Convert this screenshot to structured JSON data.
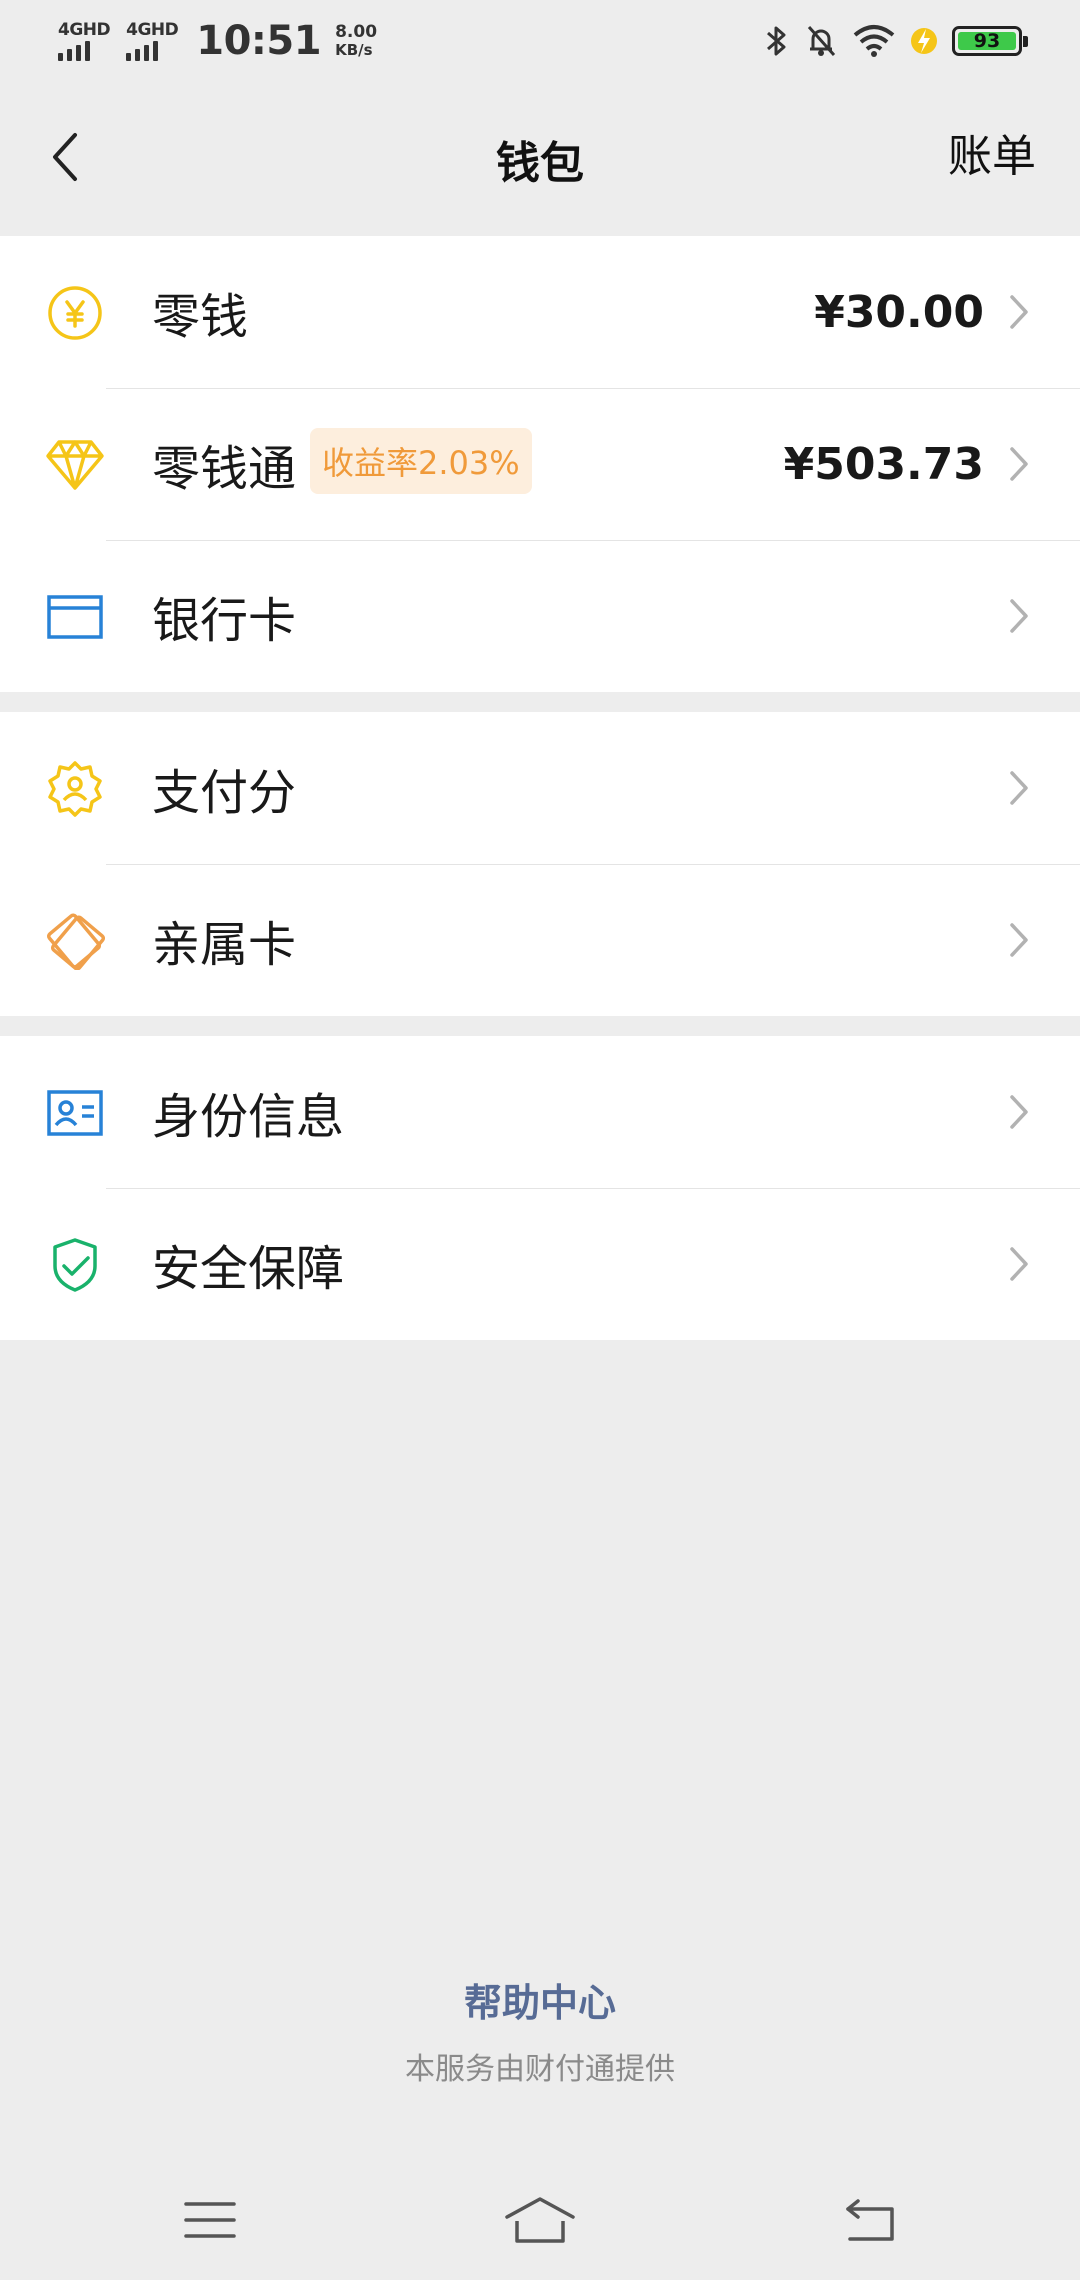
{
  "status_bar": {
    "sim1_label": "4GHD",
    "sim2_label": "4GHD",
    "time": "10:51",
    "speed_value": "8.00",
    "speed_unit": "KB/s",
    "battery_level": "93",
    "icons": [
      "bluetooth-icon",
      "mute-icon",
      "wifi-icon",
      "charging-icon",
      "battery-icon"
    ]
  },
  "nav": {
    "title": "钱包",
    "right_action": "账单",
    "back_icon": "chevron-left-icon"
  },
  "groups": [
    {
      "rows": [
        {
          "label": "零钱",
          "value": "¥30.00",
          "icon": "yuan-coin-icon"
        },
        {
          "label": "零钱通",
          "badge": "收益率2.03%",
          "value": "¥503.73",
          "icon": "diamond-icon"
        },
        {
          "label": "银行卡",
          "icon": "bank-card-icon"
        }
      ]
    },
    {
      "rows": [
        {
          "label": "支付分",
          "icon": "pay-score-icon"
        },
        {
          "label": "亲属卡",
          "icon": "family-card-icon"
        }
      ]
    },
    {
      "rows": [
        {
          "label": "身份信息",
          "icon": "id-card-icon"
        },
        {
          "label": "安全保障",
          "icon": "shield-check-icon"
        }
      ]
    }
  ],
  "footer": {
    "help_link": "帮助中心",
    "provider_text": "本服务由财付通提供"
  },
  "system_nav": {
    "icons": [
      "menu-icon",
      "home-icon",
      "back-icon"
    ]
  },
  "colors": {
    "accent_yellow": "#f5c518",
    "accent_blue": "#2782d7",
    "accent_orange": "#f09a3a",
    "accent_green": "#19b26b",
    "link_blue": "#576b95",
    "background": "#ededed"
  }
}
